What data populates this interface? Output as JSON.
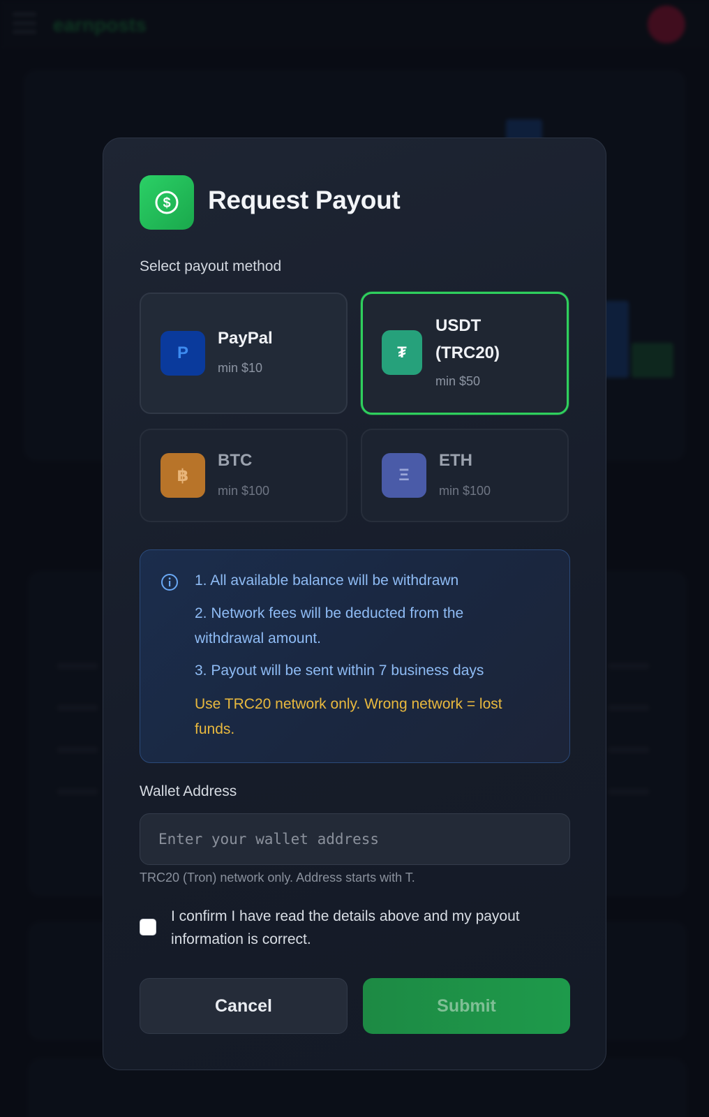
{
  "background": {
    "brand": "earnposts"
  },
  "modal": {
    "title": "Request Payout",
    "header_icon": "dollar-circle-icon",
    "method_label": "Select payout method",
    "methods": [
      {
        "name": "PayPal",
        "min": "min $10",
        "icon_glyph": "P",
        "icon": "paypal-icon",
        "color": "#0a3a9c",
        "selected": false,
        "disabled": false
      },
      {
        "name": "USDT (TRC20)",
        "min": "min $50",
        "icon_glyph": "₮",
        "icon": "tether-icon",
        "color": "#26a17b",
        "selected": true,
        "disabled": false
      },
      {
        "name": "BTC",
        "min": "min $100",
        "icon_glyph": "฿",
        "icon": "bitcoin-icon",
        "color": "#b87429",
        "selected": false,
        "disabled": true
      },
      {
        "name": "ETH",
        "min": "min $100",
        "icon_glyph": "Ξ",
        "icon": "ethereum-icon",
        "color": "#4a5ba8",
        "selected": false,
        "disabled": true
      }
    ],
    "info": {
      "icon": "info-icon",
      "lines": [
        "1. All available balance will be withdrawn",
        "2. Network fees will be deducted from the withdrawal amount.",
        "3. Payout will be sent within 7 business days"
      ],
      "warning": "Use TRC20 network only. Wrong network = lost funds."
    },
    "wallet": {
      "label": "Wallet Address",
      "placeholder": "Enter your wallet address",
      "value": "",
      "hint": "TRC20 (Tron) network only. Address starts with T."
    },
    "confirm_text": "I confirm I have read the details above and my payout information is correct.",
    "confirm_checked": false,
    "cancel_label": "Cancel",
    "submit_label": "Submit",
    "colors": {
      "accent": "#2fcf5d",
      "info_text": "#8fbcf5",
      "warning": "#e9b93e"
    }
  }
}
